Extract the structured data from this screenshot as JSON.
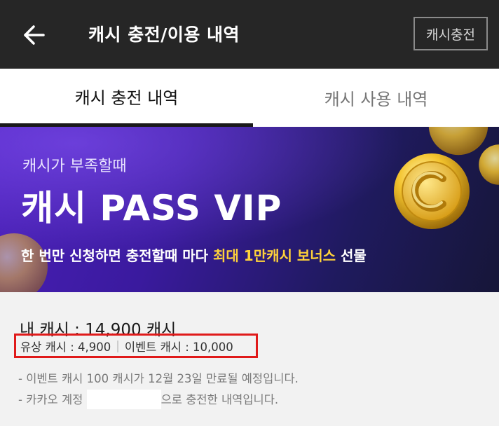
{
  "header": {
    "title": "캐시 충전/이용 내역",
    "charge_button": "캐시충전",
    "back_icon": "arrow-left-icon"
  },
  "tabs": [
    {
      "label": "캐시 충전 내역",
      "active": true
    },
    {
      "label": "캐시 사용 내역",
      "active": false
    }
  ],
  "banner": {
    "subtitle": "캐시가 부족할때",
    "title": "캐시 PASS VIP",
    "desc_prefix": "한 번만 신청하면 충전할때 마다 ",
    "desc_highlight": "최대 1만캐시 보너스",
    "desc_suffix": " 선물",
    "highlight_color": "#ffd23a",
    "coin_icon": "gold-coin-icon"
  },
  "cash": {
    "my_cash": "내 캐시 : 14,900 캐시",
    "paid_cash": "유상 캐시 : 4,900",
    "event_cash": "이벤트 캐시 : 10,000",
    "separator": "|"
  },
  "notices": {
    "expiry": "- 이벤트 캐시 100 캐시가 12월 23일 만료될 예정입니다.",
    "account_prefix": "- 카카오 계정",
    "account_suffix": "으로 충전한 내역입니다."
  },
  "colors": {
    "header_bg": "#262626",
    "highlight_box": "#e01a1a",
    "page_bg": "#f2f2f2"
  }
}
